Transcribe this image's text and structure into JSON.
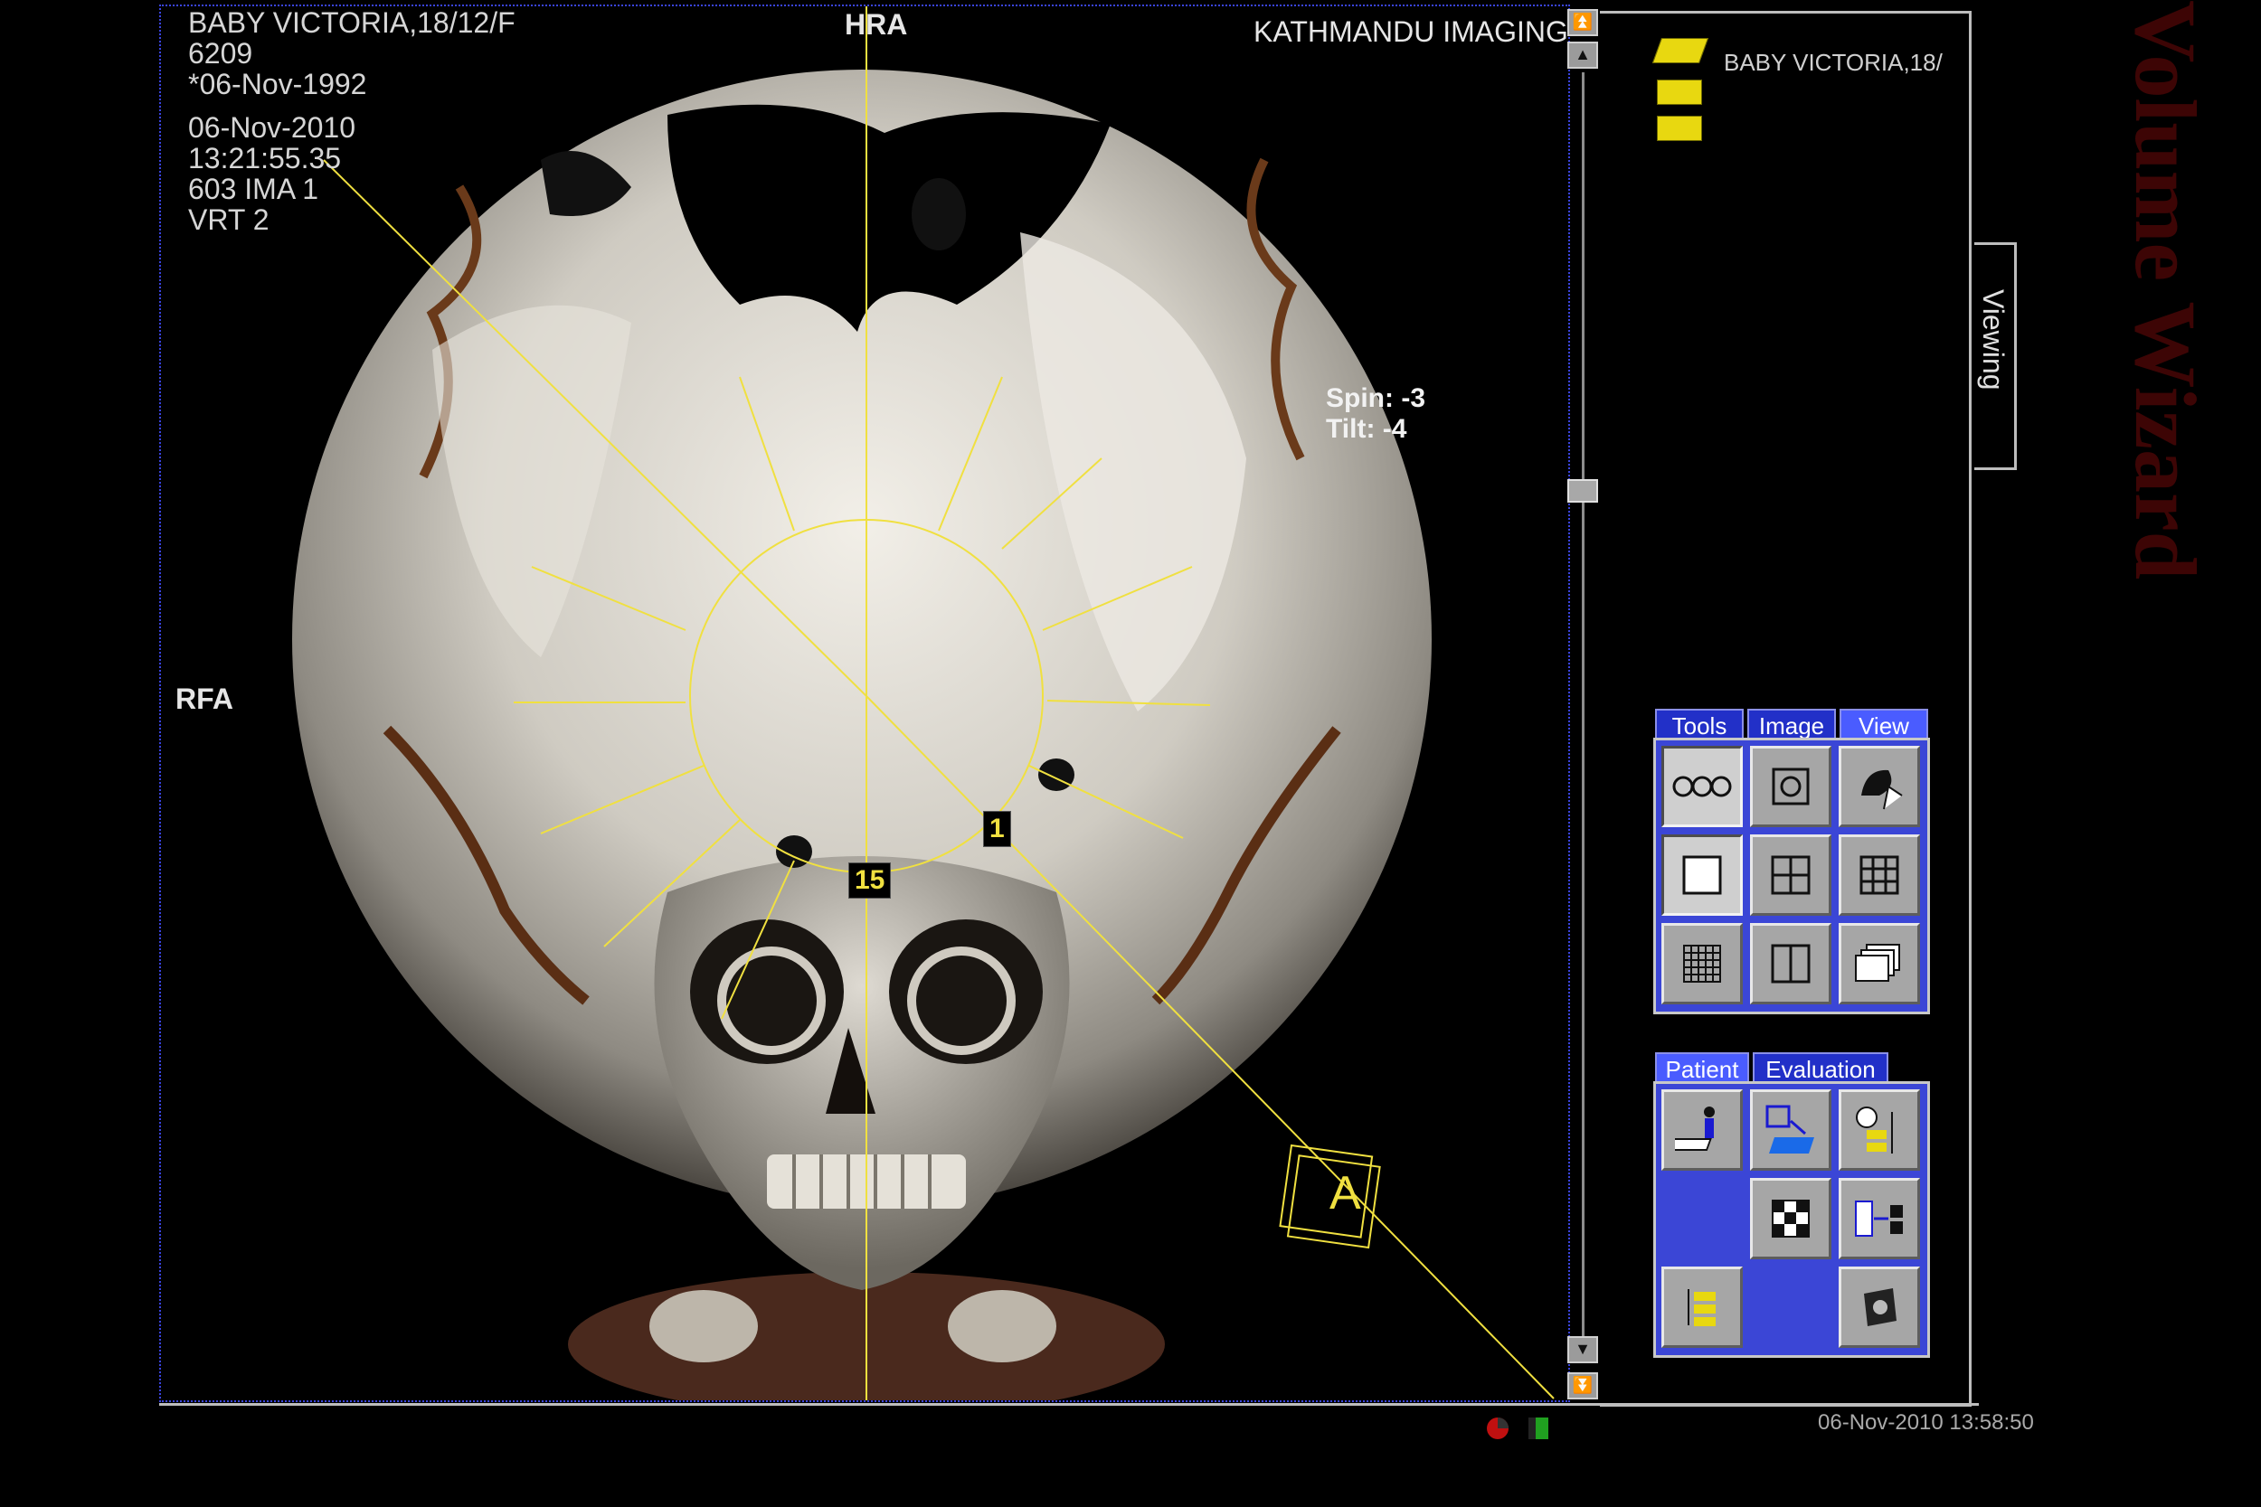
{
  "overlay": {
    "patient_line": "BABY VICTORIA,18/12/F",
    "patient_id": "6209",
    "birth_date": "*06-Nov-1992",
    "study_date": "06-Nov-2010",
    "study_time": "13:21:55.35",
    "image_info": "603 IMA 1",
    "render_mode": "VRT 2",
    "institution": "KATHMANDU IMAGING",
    "top_orientation": "HRA",
    "left_orientation": "RFA",
    "spin_label": "Spin:",
    "spin_value": "-3",
    "tilt_label": "Tilt:",
    "tilt_value": "-4",
    "marker_15": "15",
    "marker_1": "1",
    "annotation_box": "A"
  },
  "side_panel": {
    "patient_entry": "BABY VICTORIA,18/",
    "viewing_tab": "Viewing",
    "watermark": "Volume Wizard",
    "tool_tabs": [
      "Tools",
      "Image",
      "View"
    ],
    "active_tool_tab": "View",
    "patient_tabs": [
      "Patient",
      "Evaluation"
    ],
    "active_patient_tab": "Patient"
  },
  "status": {
    "datetime": "06-Nov-2010 13:58:50"
  },
  "colors": {
    "overlay_yellow": "#f0e040",
    "panel_blue": "#3b46d6",
    "viewport_border": "#3a44e0",
    "status_red": "#c01010",
    "status_green": "#20a020"
  }
}
